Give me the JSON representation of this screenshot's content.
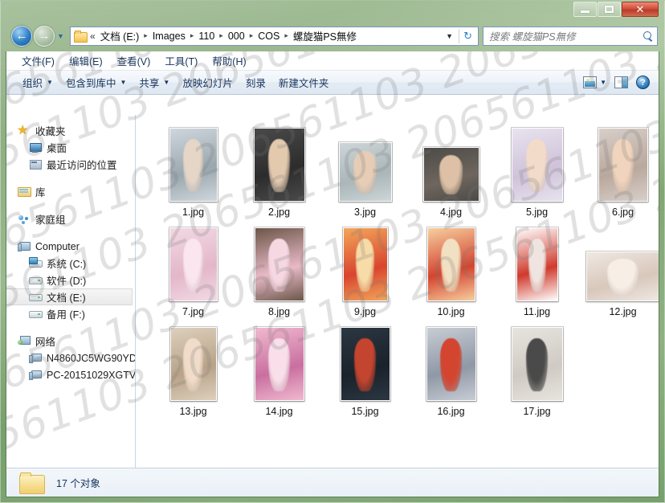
{
  "window": {
    "controls": {
      "minimize": "",
      "maximize": "",
      "close": "✕"
    }
  },
  "addressbar": {
    "back_glyph": "←",
    "forward_glyph": "→",
    "history_caret": "▼",
    "overflow": "«",
    "crumbs": [
      "文档 (E:)",
      "Images",
      "110",
      "000",
      "COS",
      "螺旋猫PS無修"
    ],
    "separator": "▸",
    "dropdown_caret": "▼",
    "refresh_glyph": "↻"
  },
  "search": {
    "placeholder": "搜索 螺旋猫PS無修",
    "icon": "search-icon"
  },
  "menubar": {
    "items": [
      "文件(F)",
      "编辑(E)",
      "查看(V)",
      "工具(T)",
      "帮助(H)"
    ]
  },
  "toolbar": {
    "items": [
      {
        "label": "组织",
        "has_caret": true
      },
      {
        "label": "包含到库中",
        "has_caret": true
      },
      {
        "label": "共享",
        "has_caret": true
      },
      {
        "label": "放映幻灯片",
        "has_caret": false
      },
      {
        "label": "刻录",
        "has_caret": false
      },
      {
        "label": "新建文件夹",
        "has_caret": false
      }
    ],
    "views_caret": "▼",
    "icons": {
      "views": "views-icon",
      "preview_pane": "preview-pane-icon",
      "help": "?"
    }
  },
  "sidebar": {
    "groups": [
      {
        "header": {
          "label": "收藏夹",
          "icon": "star-icon",
          "icon_class": "ic-star"
        },
        "children": [
          {
            "label": "桌面",
            "icon": "desktop-icon",
            "icon_class": "ic-desktop"
          },
          {
            "label": "最近访问的位置",
            "icon": "recent-places-icon",
            "icon_class": "ic-recent"
          }
        ]
      },
      {
        "header": {
          "label": "库",
          "icon": "library-icon",
          "icon_class": "ic-lib"
        },
        "children": []
      },
      {
        "header": {
          "label": "家庭组",
          "icon": "homegroup-icon",
          "icon_class": "ic-home"
        },
        "children": []
      },
      {
        "header": {
          "label": "Computer",
          "icon": "computer-icon",
          "icon_class": "ic-computer"
        },
        "children": [
          {
            "label": "系统 (C:)",
            "icon": "system-drive-icon",
            "icon_class": "ic-sysdrive"
          },
          {
            "label": "软件 (D:)",
            "icon": "drive-icon",
            "icon_class": "ic-drive"
          },
          {
            "label": "文档 (E:)",
            "icon": "drive-icon",
            "icon_class": "ic-drive",
            "selected": true
          },
          {
            "label": "备用 (F:)",
            "icon": "drive-icon",
            "icon_class": "ic-drive"
          }
        ]
      },
      {
        "header": {
          "label": "网络",
          "icon": "network-icon",
          "icon_class": "ic-network"
        },
        "children": [
          {
            "label": "N4860JC5WG90YD",
            "icon": "computer-icon",
            "icon_class": "ic-pc"
          },
          {
            "label": "PC-20151029XGTV",
            "icon": "computer-icon",
            "icon_class": "ic-pc"
          }
        ]
      }
    ]
  },
  "files": {
    "rows": [
      [
        {
          "name": "1.jpg",
          "w": 60,
          "h": 92,
          "c1": "#cfd7dd",
          "c2": "#9aa7ae",
          "c3": "#e6d6c8"
        },
        {
          "name": "2.jpg",
          "w": 64,
          "h": 92,
          "c1": "#4a4a4a",
          "c2": "#2c2c2c",
          "c3": "#e3c9ae"
        },
        {
          "name": "3.jpg",
          "w": 66,
          "h": 74,
          "c1": "#cdd6d8",
          "c2": "#aab6b8",
          "c3": "#e7cdb6"
        },
        {
          "name": "4.jpg",
          "w": 70,
          "h": 68,
          "c1": "#4d4a47",
          "c2": "#6e665e",
          "c3": "#ddc0a6"
        },
        {
          "name": "5.jpg",
          "w": 64,
          "h": 92,
          "c1": "#e8e2ef",
          "c2": "#cfc3d9",
          "c3": "#f2dcc9"
        },
        {
          "name": "6.jpg",
          "w": 62,
          "h": 92,
          "c1": "#d8cfc9",
          "c2": "#b9a89c",
          "c3": "#f0d4bd"
        }
      ],
      [
        {
          "name": "7.jpg",
          "w": 60,
          "h": 92,
          "c1": "#f2d9e4",
          "c2": "#e3b7c9",
          "c3": "#fbe6ef"
        },
        {
          "name": "8.jpg",
          "w": 62,
          "h": 92,
          "c1": "#6b5648",
          "c2": "#e8b9c6",
          "c3": "#f6d8e2"
        },
        {
          "name": "9.jpg",
          "w": 56,
          "h": 92,
          "c1": "#f3a65a",
          "c2": "#d8452f",
          "c3": "#f7dca8"
        },
        {
          "name": "10.jpg",
          "w": 60,
          "h": 92,
          "c1": "#f6cf9f",
          "c2": "#d4442f",
          "c3": "#f2e0c2"
        },
        {
          "name": "11.jpg",
          "w": 52,
          "h": 92,
          "c1": "#ffffff",
          "c2": "#cf3a2c",
          "c3": "#efe4e0"
        },
        {
          "name": "12.jpg",
          "w": 92,
          "h": 62,
          "c1": "#efe8e2",
          "c2": "#d8c7bb",
          "c3": "#f7eee6"
        }
      ],
      [
        {
          "name": "13.jpg",
          "w": 58,
          "h": 92,
          "c1": "#ddd0bd",
          "c2": "#b8a288",
          "c3": "#f0dcc8"
        },
        {
          "name": "14.jpg",
          "w": 62,
          "h": 92,
          "c1": "#f0b9cf",
          "c2": "#c96fa0",
          "c3": "#f8dfe9"
        },
        {
          "name": "15.jpg",
          "w": 62,
          "h": 92,
          "c1": "#2b3742",
          "c2": "#1a222b",
          "c3": "#c4452f"
        },
        {
          "name": "16.jpg",
          "w": 62,
          "h": 92,
          "c1": "#c8ccd4",
          "c2": "#8f98a6",
          "c3": "#d4452f"
        },
        {
          "name": "17.jpg",
          "w": 64,
          "h": 92,
          "c1": "#e7e4df",
          "c2": "#cfcac3",
          "c3": "#4a4a4a"
        }
      ]
    ]
  },
  "statusbar": {
    "item_count_label": "17 个对象",
    "folder_icon": "folder-icon"
  },
  "watermark": {
    "text": "206561103",
    "repeat": 4,
    "lines": 7
  },
  "colors": {
    "frame_green": "#5d7f52",
    "accent_blue": "#16335c",
    "close_red": "#c0392b",
    "selection_gray": "#eaeaea"
  }
}
